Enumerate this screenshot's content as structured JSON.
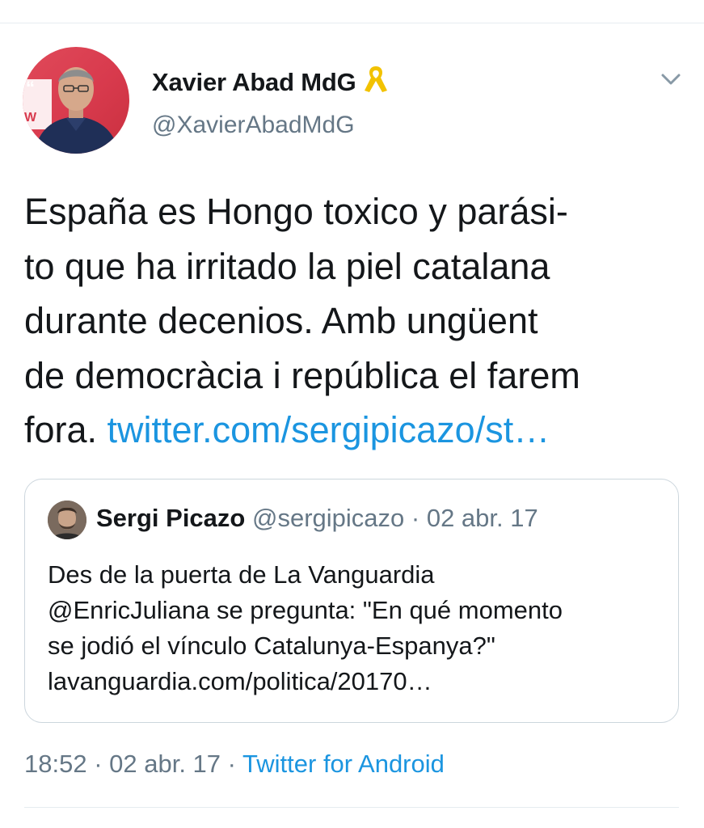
{
  "tweet": {
    "author_name": "Xavier Abad MdG",
    "author_handle": "@XavierAbadMdG",
    "text_lines": [
      "España es Hongo toxico y parási-",
      "to que ha irritado la piel catalana",
      "durante decenios. Amb ungüent",
      "de democràcia i república el farem",
      "fora. "
    ],
    "link_text": "twitter.com/sergipicazo/st…",
    "timestamp": "18:52",
    "date": "02 abr. 17",
    "separator": " · ",
    "source": "Twitter for Android"
  },
  "quoted": {
    "author_name": "Sergi Picazo",
    "author_handle": "@sergipicazo",
    "date": "02 abr. 17",
    "separator": " · ",
    "text_lines": [
      "Des de la puerta de La Vanguardia",
      "@EnricJuliana se pregunta: \"En qué momento",
      "se jodió el vínculo Catalunya-Espanya?\"",
      "lavanguardia.com/politica/20170…"
    ]
  },
  "avatar_text": "W",
  "colors": {
    "link": "#1b95e0",
    "secondary_text": "#657786",
    "border": "#ccd6dd",
    "ribbon": "#f2c200"
  },
  "icons": {
    "ribbon": "yellow-ribbon-icon",
    "caret": "chevron-down-icon"
  }
}
